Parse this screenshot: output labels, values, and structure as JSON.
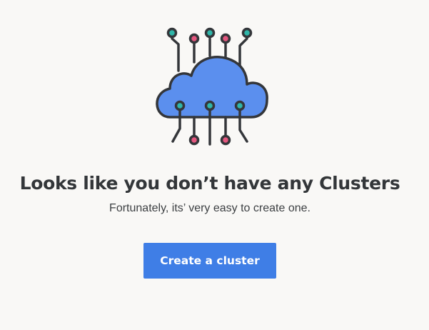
{
  "empty_state": {
    "illustration_icon": "cloud-circuit-icon",
    "title": "Looks like you don’t have any Clusters",
    "subtitle": "Fortunately, its’ very easy to create one.",
    "create_button_label": "Create a cluster"
  },
  "colors": {
    "background": "#f9f8f6",
    "accent": "#3f7ee6",
    "cloud_fill": "#5b8fee",
    "outline": "#34363a",
    "node_teal": "#2fb6a9",
    "node_pink": "#e4577f"
  }
}
